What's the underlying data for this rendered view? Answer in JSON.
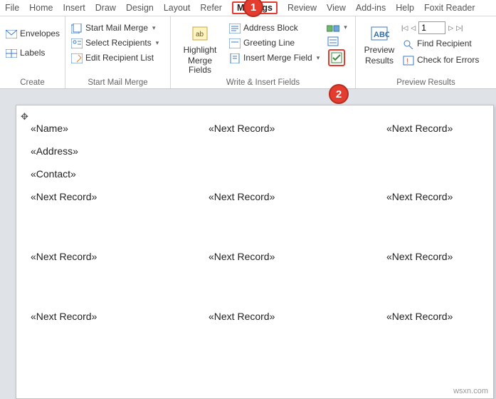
{
  "tabs": {
    "file": "File",
    "home": "Home",
    "insert": "Insert",
    "draw": "Draw",
    "design": "Design",
    "layout": "Layout",
    "references": "Refer",
    "mailings": "Mailings",
    "review": "Review",
    "view": "View",
    "addins": "Add-ins",
    "help": "Help",
    "foxit": "Foxit Reader"
  },
  "callouts": {
    "one": "1",
    "two": "2"
  },
  "ribbon": {
    "create": {
      "envelopes": "Envelopes",
      "labels": "Labels",
      "group": "Create"
    },
    "start": {
      "start_merge": "Start Mail Merge",
      "select_recipients": "Select Recipients",
      "edit_recipients": "Edit Recipient List",
      "group": "Start Mail Merge"
    },
    "write": {
      "highlight_l1": "Highlight",
      "highlight_l2": "Merge Fields",
      "address_block": "Address Block",
      "greeting_line": "Greeting Line",
      "insert_merge_field": "Insert Merge Field",
      "group": "Write & Insert Fields"
    },
    "preview": {
      "preview_l1": "Preview",
      "preview_l2": "Results",
      "record_value": "1",
      "find_recipient": "Find Recipient",
      "check_errors": "Check for Errors",
      "group": "Preview Results"
    }
  },
  "doc": {
    "r0c0": "«Name»",
    "r0c1": "«Next Record»",
    "r0c2": "«Next Record»",
    "r1c0": "«Address»",
    "r2c0": "«Contact»",
    "r3c0": "«Next Record»",
    "r3c1": "«Next Record»",
    "r3c2": "«Next Record»",
    "r4c0": "«Next Record»",
    "r4c1": "«Next Record»",
    "r4c2": "«Next Record»",
    "r5c0": "«Next Record»",
    "r5c1": "«Next Record»",
    "r5c2": "«Next Record»"
  },
  "watermark": "wsxn.com"
}
